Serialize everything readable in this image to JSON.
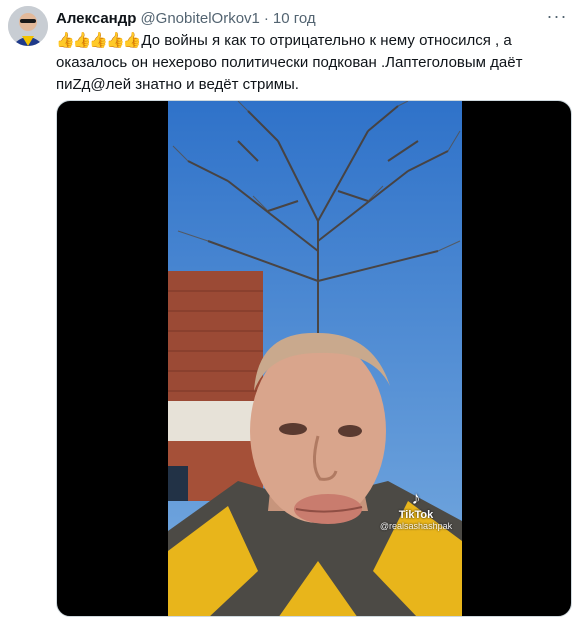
{
  "tweet": {
    "author_name": "Александр",
    "author_handle": "@GnobitelOrkov1",
    "separator": "·",
    "time": "10 год",
    "emoji": "👍👍👍👍👍",
    "text": "До войны я как то отрицательно к нему относился , а оказалось он нехерово политически подкован .Лаптеголовым даёт пиZд@лей знатно и ведёт стримы."
  },
  "media": {
    "watermark_brand": "TikTok",
    "watermark_user": "@realsashashpak"
  },
  "icons": {
    "more": "more-dots-icon",
    "tiktok": "tiktok-logo-icon"
  },
  "colors": {
    "name": "#0f1419",
    "secondary": "#536471",
    "media_background": "#000000"
  }
}
